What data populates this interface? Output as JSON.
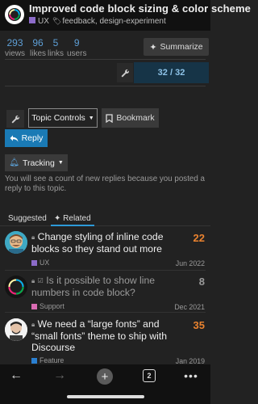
{
  "header": {
    "title": "Improved code block sizing & color scheme",
    "category": "UX",
    "category_color": "#8c6bc8",
    "tags": "feedback, design-experiment"
  },
  "stats": [
    {
      "value": "293",
      "label": "views"
    },
    {
      "value": "96",
      "label": "likes"
    },
    {
      "value": "5",
      "label": "links"
    },
    {
      "value": "9",
      "label": "users"
    }
  ],
  "summarize_label": "Summarize",
  "progress": {
    "text": "32 / 32",
    "fraction": 1.0
  },
  "controls": {
    "topic_controls_label": "Topic Controls",
    "bookmark_label": "Bookmark",
    "reply_label": "Reply"
  },
  "tracking": {
    "label": "Tracking",
    "description": "You will see a count of new replies because you posted a reply to this topic."
  },
  "tabs": [
    {
      "label": "Suggested",
      "active": false
    },
    {
      "label": "Related",
      "active": true
    }
  ],
  "suggested": [
    {
      "title": "Change styling of inline code blocks so they stand out more",
      "count": "22",
      "count_color": "#e9822f",
      "category": "UX",
      "category_color": "#8c6bc8",
      "date": "Jun 2022",
      "muted": false
    },
    {
      "title": "Is it possible to show line numbers in code block?",
      "count": "8",
      "count_color": "#9a9a9a",
      "category": "Support",
      "category_color": "#d96bb2",
      "date": "Dec 2021",
      "muted": true
    },
    {
      "title": "We need a “large fonts” and “small fonts” theme to ship with Discourse",
      "count": "35",
      "count_color": "#e9822f",
      "category": "Feature",
      "category_color": "#2a7fd0",
      "date": "Jan 2019",
      "muted": false
    }
  ],
  "bottom_nav": {
    "tab_count": "2"
  }
}
